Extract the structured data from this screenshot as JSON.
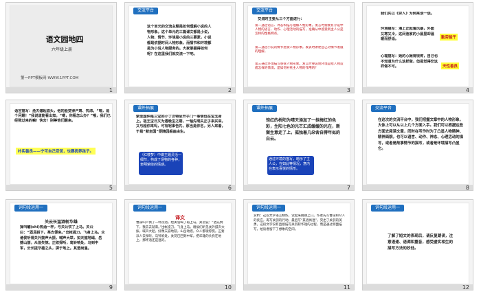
{
  "slides": [
    {
      "num": "1",
      "title": "语文园地四",
      "subtitle": "六年级上册",
      "footer": "第一PPT模板网-WWW.1PPT.COM"
    },
    {
      "num": "2",
      "header": "交流平台",
      "body": "这个单元的交流主题是如何理解小说的人物形象。这个单元的三篇课文都是小说，人物、情节、环境是小说的三要素，小说都是依据时间人物形象，而情节和环境都是为小说人物服务的。大家掌握得如何呢？在这里我们就交流一下吧。"
    },
    {
      "num": "3",
      "header": "交流平台",
      "intro": "交流时主要从三个方面进行：",
      "p1": "第一通过语言、神态和描写理解人物形象。发言时需要有小说中人物的语言、动作、心理活动的描写，准确从中感受到主人公是怎样的性格特点。",
      "p2": "第二通过小说的情节感受人物形象。发表时讲述自己对情节发展的理解。",
      "p3": "第三通过环境描写感受人物形象。发言时要说明环境是给人物造成怎样的情境，是如何衬托主人物的作用的？"
    },
    {
      "num": "4",
      "lead": "我们先以《穷人》为例来谈一谈。",
      "env": "环境描写：海上正起着风暴，外面又寒又冷，这间渔家的小屋里却温暖而舒适。",
      "envtag": "勤劳能干",
      "psy": "心理描写：她的心揪得很疼，自己也不知道为什么这样做，但是觉得非这样做不可。",
      "psytag": "天性善良"
    },
    {
      "num": "5",
      "body": "语言描写：渔夫皱起眉头，他的脸变得严肃、忧虑。“嗯，是个问题！”我说道能看出知，“嗯，你看怎么办？”哦，我们已经熬过来的嘛！快去！别等他们醒来。",
      "band": "朴实善良——宁可自己受苦，也要抚养孩子。"
    },
    {
      "num": "6",
      "header": "课外拓展",
      "body": "萦圭国仲是三宝的小丁次特至开子门一事情低在宝玉身上。祖王宝日又为遇晚宝之期，一轴先明夫正子来买来，又与超你来吗，可有呢事告先，那当是你名，另人来着，于是“萦圭国”便随园般画由生。",
      "note": "（红楼梦）中做主题灵活一细节，构成了场物的各种，表明萦绕的情感。"
    },
    {
      "num": "7",
      "header": "课外拓展",
      "body": "饱红的桥阳为晴天添加了一抹梅红的色彩，生阳七色的光芒汇成缓缓的光在，新案生意走了上，孤独着几朵舍自得年似的白云。",
      "note": "通过环境的描写，暗示了主人公，在如此等情况，意内在表示喜悦的情形。"
    },
    {
      "num": "8",
      "header": "交流平台",
      "body": "在这次的交流平台中，我们把握文章中的人物形象，大体上可以从以上几个方面入手。我们可以根据这些方面去阅读文章，同时在写作时为了凸显人物精神、精神面貌，也可以语言、动作、神态、心理活动的描写，或者是故事情节的描写，或者是环境描写凸显它。"
    },
    {
      "num": "9",
      "header": "词句段运用一",
      "title": "关云长温酒斩华雄",
      "body": "操叫酾(shi)热酒一杯，与关公饮了上马。关公曰：“酒且斟下，某去便来。”出帐提刀，飞身上马。众诸侯听得关外鼓声大振，喊声大举，如天摧地塌，岳撼山崩，众皆失惊。正欲探听，鸾铃响处，马到中军，云长提华雄之头，掷于地上。其酒尚温。"
    },
    {
      "num": "10",
      "header": "词句段运用一",
      "title": "译文",
      "body": "曹操叫人倒了一杯热酒，给关羽喝了再上马。关羽说：“酒先倒下，我去去就来。”出帐提刀，飞身上马。诸侯们听见关外鼓声大振，喊声大起，好像天崩地裂，山岳动摇，众人都很惊慌。正要派人去探听，马铃响处，关羽已回到中军，把华雄的头扔在地上，那杯酒还是温的。"
    },
    {
      "num": "11",
      "header": "词句段运用一",
      "body": "赏析：这段文字语言精炼，读起来朗朗上口。作者先写曹操和众人的反应，再写关羽的行动，最后写“其酒尚温”，突出了关羽的英勇。这段文字没有直接描写关羽斩华雄的过程，而是通过侧面描写，给读者留下了想象的空间。"
    },
    {
      "num": "12",
      "header": "词句段运用一",
      "body": "了解了短文的表现后，请反复朗读，注意语速、语调和重音，感受虚实相生的描写方法的妙处。"
    }
  ]
}
